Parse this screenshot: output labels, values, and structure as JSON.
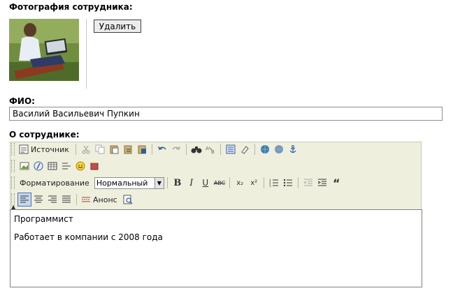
{
  "photo": {
    "label": "Фотография сотрудника:",
    "delete_button": "Удалить"
  },
  "fio": {
    "label": "ФИО:",
    "value": "Василий Васильевич Пупкин"
  },
  "about": {
    "label": "О сотруднике:"
  },
  "toolbar": {
    "source_label": "Источник",
    "format_label": "Форматирование",
    "format_value": "Нормальный",
    "announce_label": "Анонс"
  },
  "editor": {
    "paragraphs": [
      "Программист",
      "Работает в компании с 2008 года"
    ]
  },
  "colors": {
    "toolbar_bg": "#efefde",
    "active_btn": "#c7d7ef"
  }
}
